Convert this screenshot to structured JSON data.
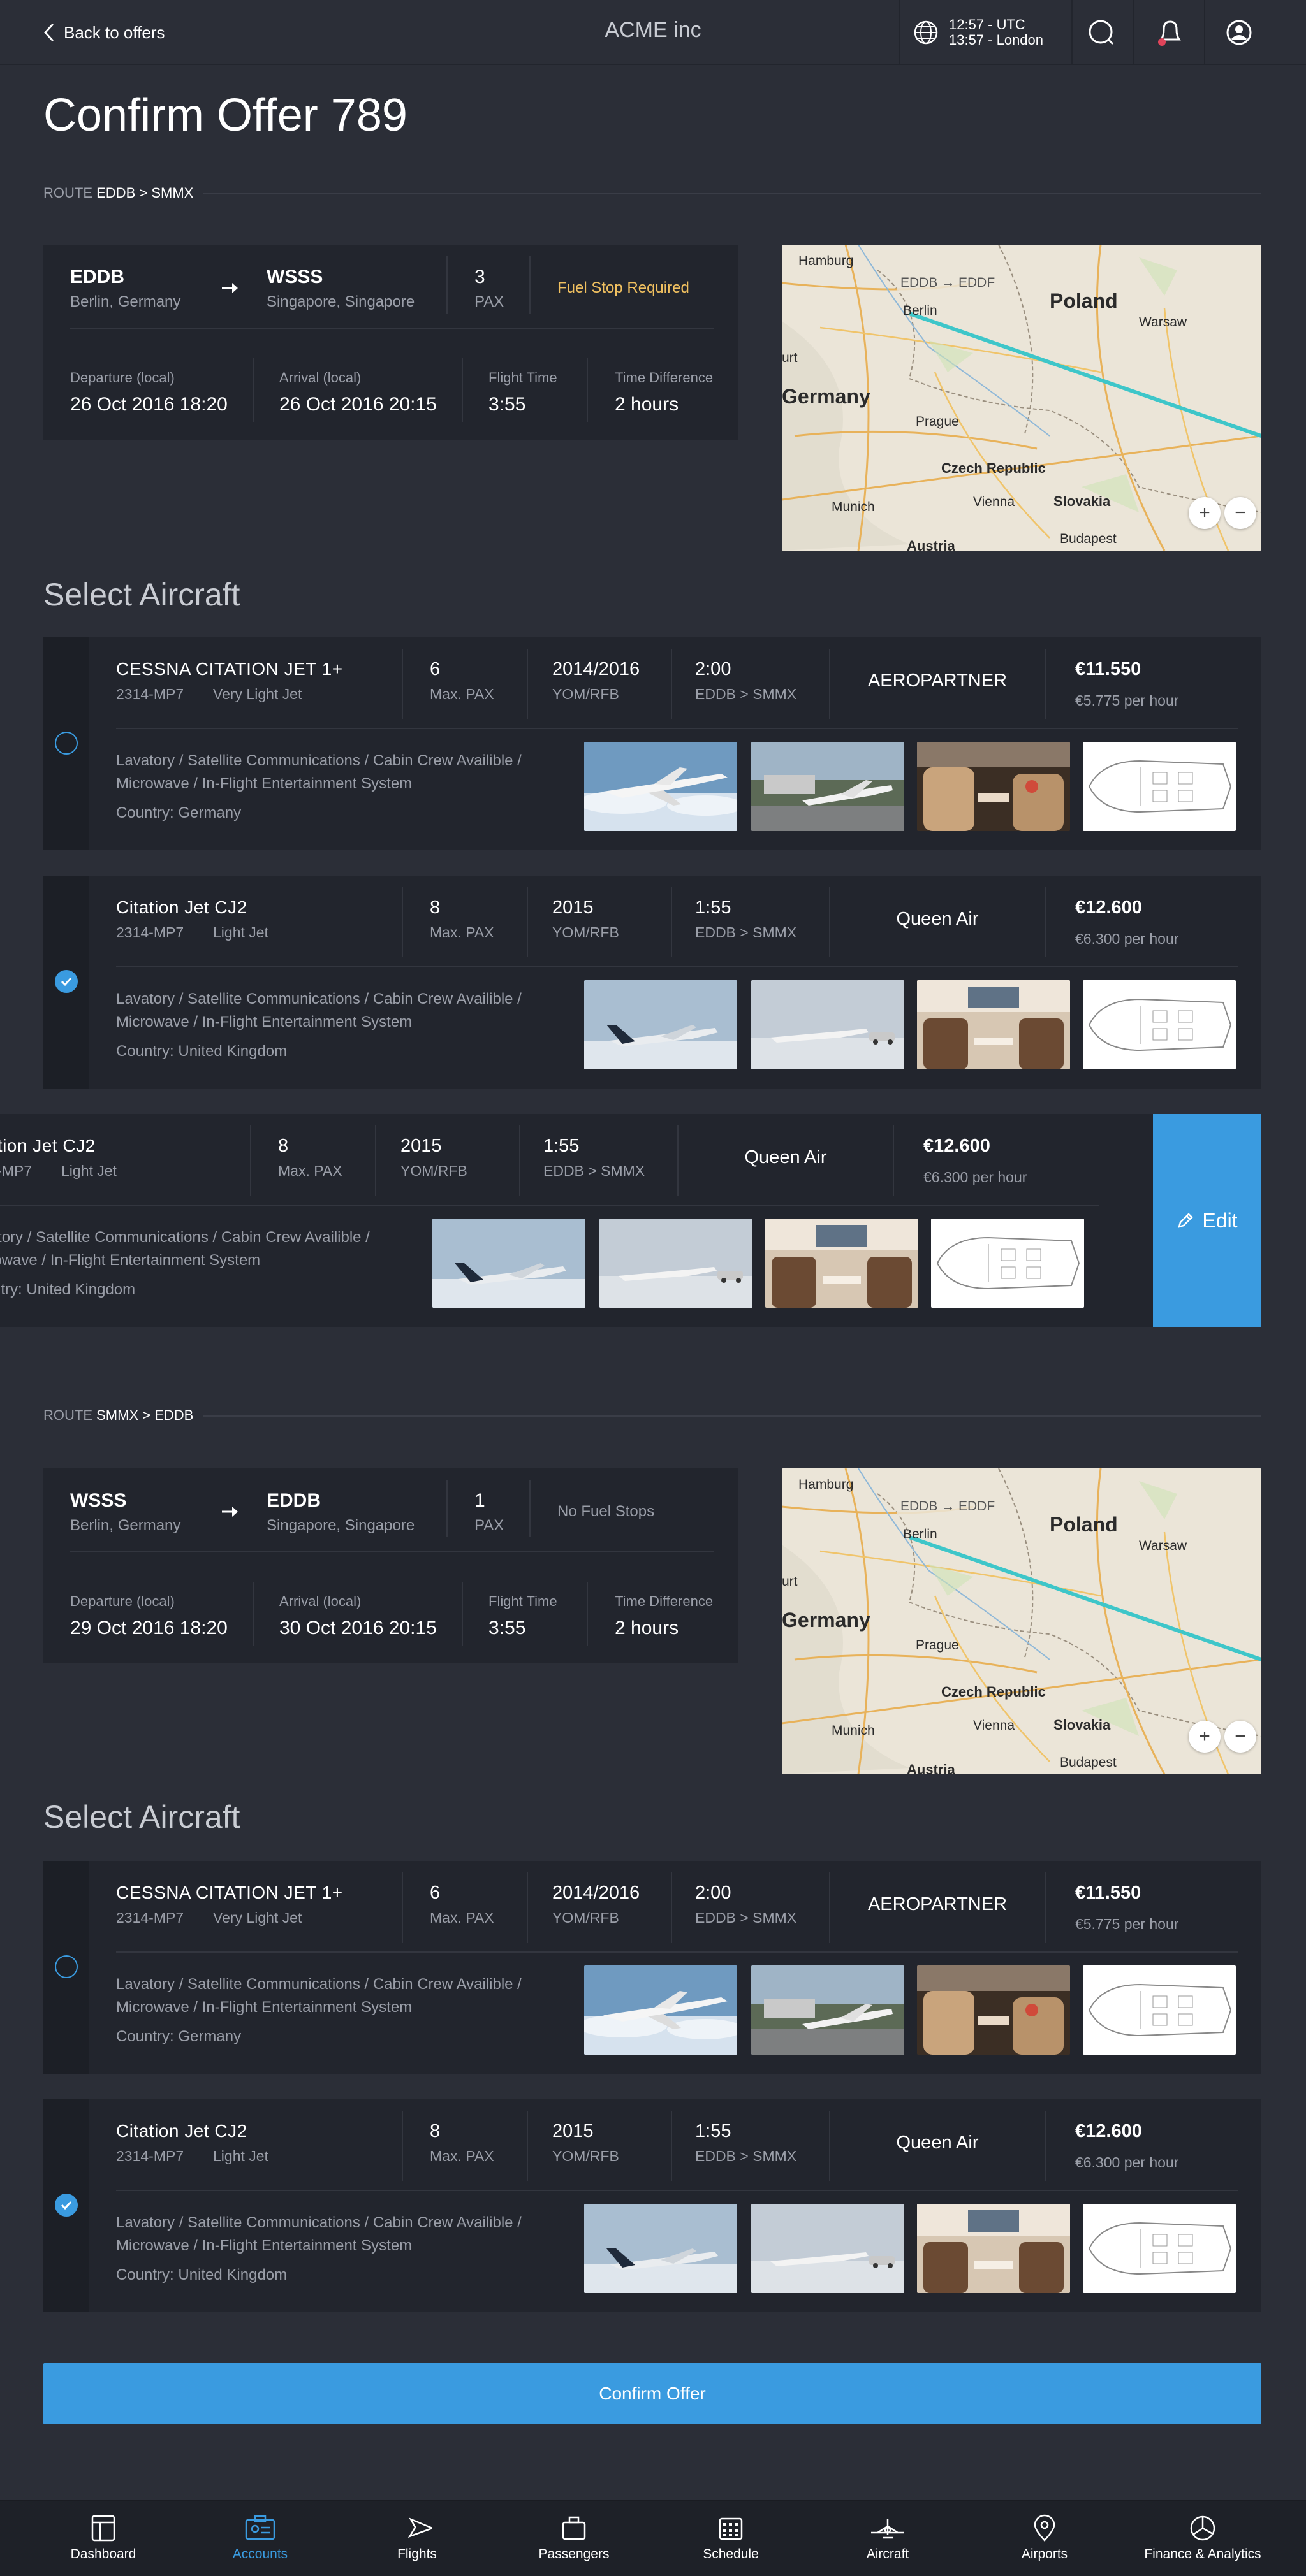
{
  "header": {
    "back_label": "Back to offers",
    "brand": "ACME inc",
    "clock_utc": "12:57 - UTC",
    "clock_local": "13:57 - London"
  },
  "page": {
    "title": "Confirm Offer 789"
  },
  "route1": {
    "route_prefix": "ROUTE",
    "route_value": "EDDB > SMMX",
    "from_code": "EDDB",
    "from_city": "Berlin, Germany",
    "to_code": "WSSS",
    "to_city": "Singapore, Singapore",
    "pax_value": "3",
    "pax_label": "PAX",
    "fuel": "Fuel Stop Required",
    "dep_label": "Departure (local)",
    "dep_value": "26 Oct 2016 18:20",
    "arr_label": "Arrival (local)",
    "arr_value": "26 Oct 2016 20:15",
    "ft_label": "Flight Time",
    "ft_value": "3:55",
    "td_label": "Time Difference",
    "td_value": "2 hours"
  },
  "route2": {
    "route_prefix": "ROUTE",
    "route_value": "SMMX > EDDB",
    "from_code": "WSSS",
    "from_city": "Berlin, Germany",
    "to_code": "EDDB",
    "to_city": "Singapore, Singapore",
    "pax_value": "1",
    "pax_label": "PAX",
    "fuel": "No Fuel Stops",
    "dep_label": "Departure (local)",
    "dep_value": "29 Oct 2016 18:20",
    "arr_label": "Arrival (local)",
    "arr_value": "30 Oct 2016 20:15",
    "ft_label": "Flight Time",
    "ft_value": "3:55",
    "td_label": "Time Difference",
    "td_value": "2 hours"
  },
  "map": {
    "route_label": "EDDB → EDDF",
    "labels": [
      "Hamburg",
      "Berlin",
      "Poland",
      "Warsaw",
      "Germany",
      "Prague",
      "Czech Republic",
      "Slovakia",
      "Munich",
      "Vienna",
      "Austria",
      "Budapest",
      "urt"
    ],
    "zoom_in": "+",
    "zoom_out": "−"
  },
  "select_aircraft_title": "Select Aircraft",
  "aircraft": [
    {
      "name": "CESSNA CITATION JET 1+",
      "reg": "2314-MP7",
      "class": "Very Light Jet",
      "pax_value": "6",
      "pax_label": "Max. PAX",
      "yom_value": "2014/2016",
      "yom_label": "YOM/RFB",
      "time_value": "2:00",
      "time_label": "EDDB > SMMX",
      "operator": "AEROPARTNER",
      "price": "€11.550",
      "price_hour": "€5.775 per hour",
      "desc1": "Lavatory / Satellite Communications / Cabin Crew Availible /",
      "desc2": "Microwave / In-Flight Entertainment System",
      "country": "Country: Germany"
    },
    {
      "name": "Citation Jet CJ2",
      "reg": "2314-MP7",
      "class": "Light Jet",
      "pax_value": "8",
      "pax_label": "Max. PAX",
      "yom_value": "2015",
      "yom_label": "YOM/RFB",
      "time_value": "1:55",
      "time_label": "EDDB > SMMX",
      "operator": "Queen Air",
      "price": "€12.600",
      "price_hour": "€6.300 per hour",
      "desc1": "Lavatory / Satellite Communications / Cabin Crew Availible /",
      "desc2": "Microwave / In-Flight Entertainment System",
      "country": "Country: United Kingdom"
    }
  ],
  "edit_label": "Edit",
  "confirm_label": "Confirm Offer",
  "tabs": [
    "Dashboard",
    "Accounts",
    "Flights",
    "Passengers",
    "Schedule",
    "Aircraft",
    "Airports",
    "Finance & Analytics"
  ],
  "colors": {
    "accent": "#3a9be0",
    "fuel_warning": "#f0c060",
    "background": "#2b2e37",
    "card": "#22252d"
  }
}
